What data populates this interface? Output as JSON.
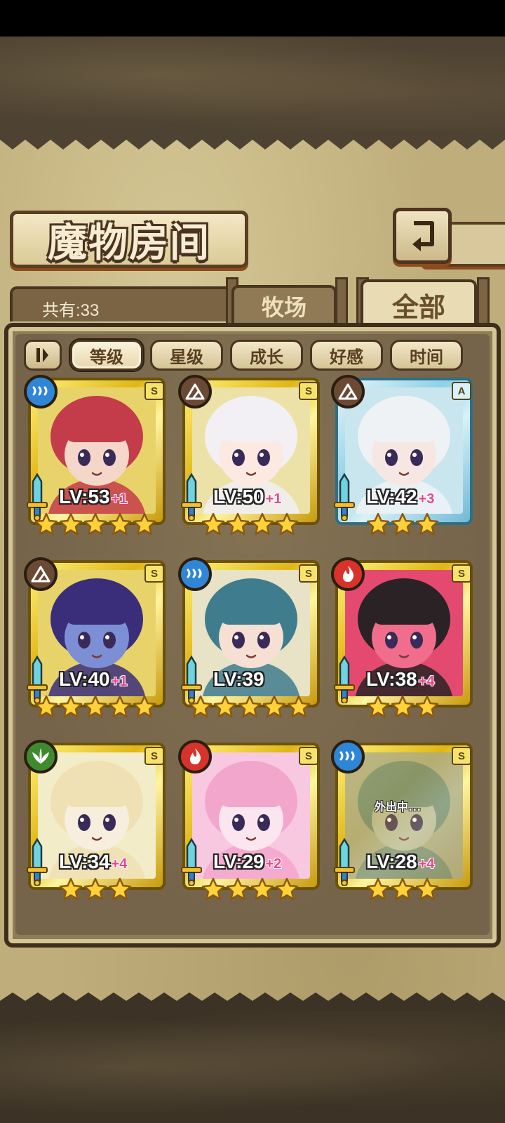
{
  "header": {
    "title": "魔物房间"
  },
  "summary": {
    "count_label": "共有:33"
  },
  "tabs": [
    {
      "label": "牧场",
      "active": false
    },
    {
      "label": "全部",
      "active": true
    }
  ],
  "sort": {
    "toggle_icon": "sort-order-icon",
    "options": [
      {
        "label": "等级",
        "active": true
      },
      {
        "label": "星级",
        "active": false
      },
      {
        "label": "成长",
        "active": false
      },
      {
        "label": "好感",
        "active": false
      },
      {
        "label": "时间",
        "active": false
      }
    ]
  },
  "element_colors": {
    "water": "#2f86d6",
    "earth": "#6b4a35",
    "fire": "#d8332a",
    "wood": "#3f8a2e"
  },
  "monsters": [
    {
      "level": "LV:53",
      "bonus": "+1",
      "rank": "S",
      "element": "water",
      "stars": 5,
      "frame": "gold",
      "status": "",
      "art": {
        "hair": "#c43b4a",
        "skin": "#f4d7c8",
        "bg": "#e8d36a"
      }
    },
    {
      "level": "LV:50",
      "bonus": "+1",
      "rank": "S",
      "element": "earth",
      "stars": 4,
      "frame": "gold",
      "status": "",
      "art": {
        "hair": "#f2f0f4",
        "skin": "#fbe9e2",
        "bg": "#ece2a8"
      }
    },
    {
      "level": "LV:42",
      "bonus": "+3",
      "rank": "A",
      "element": "earth",
      "stars": 3,
      "frame": "blue",
      "status": "",
      "art": {
        "hair": "#eef2f4",
        "skin": "#f7e7e2",
        "bg": "#c9e6ef"
      }
    },
    {
      "level": "LV:40",
      "bonus": "+1",
      "rank": "S",
      "element": "earth",
      "stars": 5,
      "frame": "gold",
      "status": "",
      "art": {
        "hair": "#3a2e7a",
        "skin": "#7d8fd4",
        "bg": "#e8d36a"
      }
    },
    {
      "level": "LV:39",
      "bonus": "",
      "rank": "S",
      "element": "water",
      "stars": 5,
      "frame": "gold",
      "status": "",
      "art": {
        "hair": "#3f7d8e",
        "skin": "#f6dfd3",
        "bg": "#e8e3c6"
      }
    },
    {
      "level": "LV:38",
      "bonus": "+4",
      "rank": "S",
      "element": "fire",
      "stars": 3,
      "frame": "gold",
      "status": "",
      "art": {
        "hair": "#2a2224",
        "skin": "#f06d8b",
        "bg": "#e44a6f"
      }
    },
    {
      "level": "LV:34",
      "bonus": "+4",
      "rank": "S",
      "element": "wood",
      "stars": 3,
      "frame": "gold",
      "status": "",
      "art": {
        "hair": "#efe1b4",
        "skin": "#f8eedd",
        "bg": "#f3ecc8"
      }
    },
    {
      "level": "LV:29",
      "bonus": "+2",
      "rank": "S",
      "element": "fire",
      "stars": 4,
      "frame": "gold",
      "status": "",
      "art": {
        "hair": "#f3a6cc",
        "skin": "#fbe5ee",
        "bg": "#f7c8df"
      }
    },
    {
      "level": "LV:28",
      "bonus": "+4",
      "rank": "S",
      "element": "water",
      "stars": 3,
      "frame": "gold",
      "status": "外出中...",
      "art": {
        "hair": "#6c8a80",
        "skin": "#b6bca8",
        "bg": "#a8aa90"
      }
    }
  ]
}
